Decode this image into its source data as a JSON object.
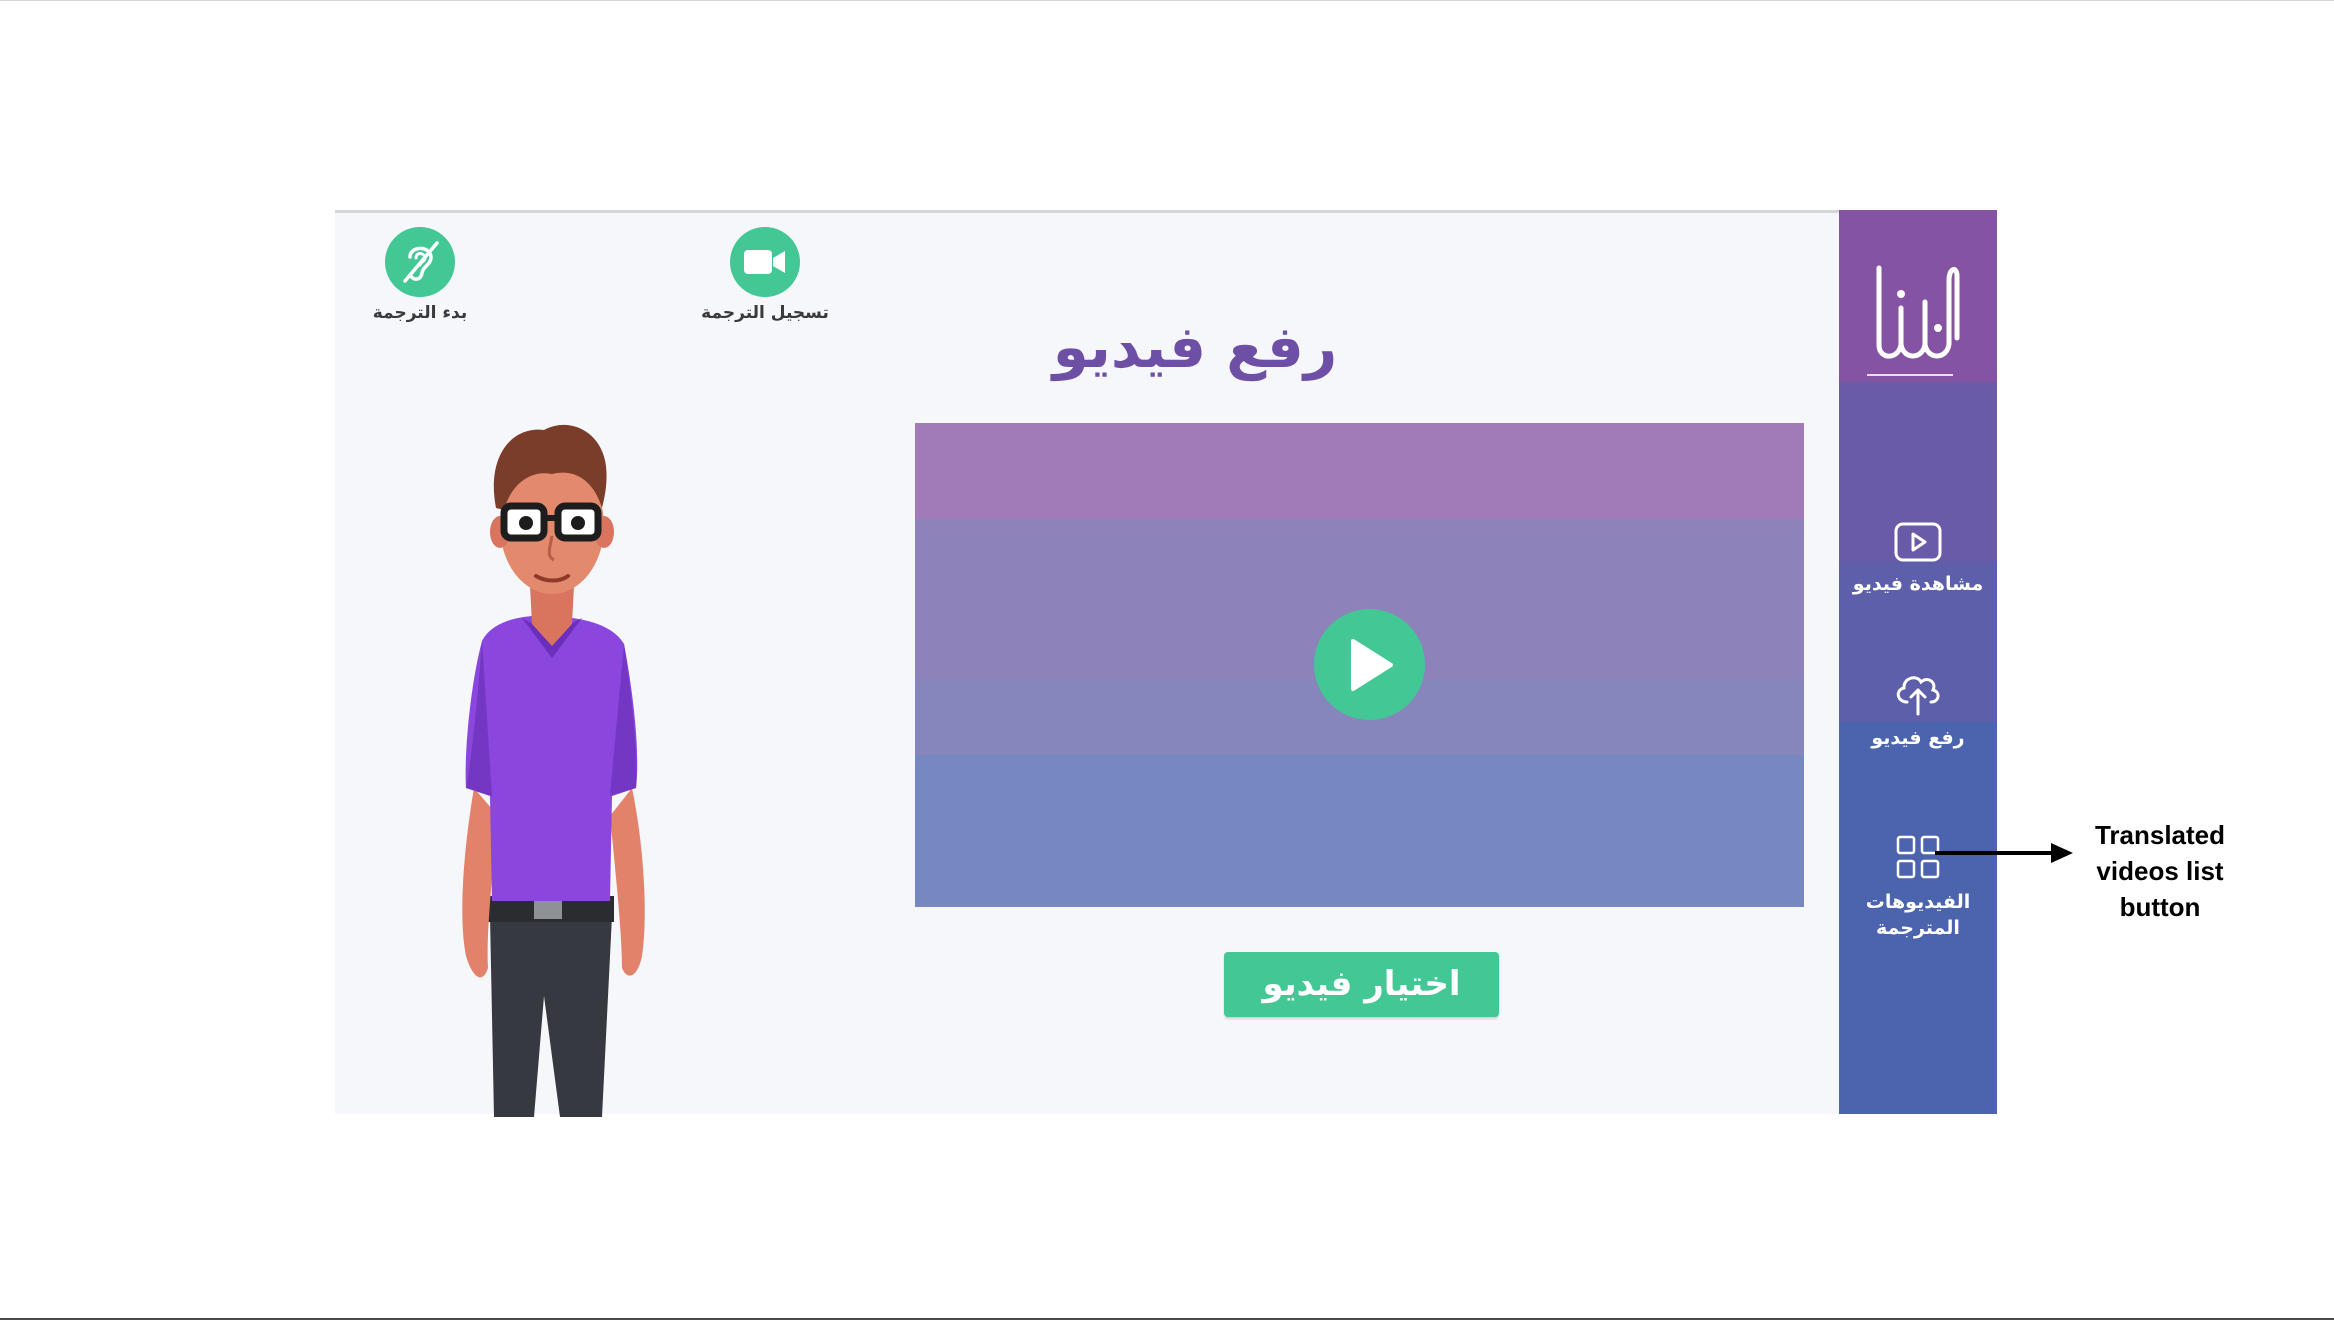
{
  "toolbar": {
    "interpret_label": "بدء الترجمة",
    "record_label": "تسجيل الترجمة"
  },
  "main": {
    "title": "رفع فيديو",
    "choose_button_label": "اختيار فيديو"
  },
  "sidebar": {
    "logo_text": "ايدنا",
    "items": [
      {
        "label": "مشاهدة فيديو",
        "icon": "play-square-icon"
      },
      {
        "label": "رفع فيديو",
        "icon": "cloud-upload-icon"
      },
      {
        "label": "الفيديوهات المترجمة",
        "icon": "grid-icon"
      }
    ]
  },
  "annotation": {
    "text": "Translated videos list button"
  },
  "colors": {
    "accent_green": "#43c795",
    "sidebar_top": "#8553a3",
    "sidebar_mid": "#6a5ba8",
    "sidebar_bottom": "#4c64ad",
    "title_purple": "#6d4fa6"
  }
}
